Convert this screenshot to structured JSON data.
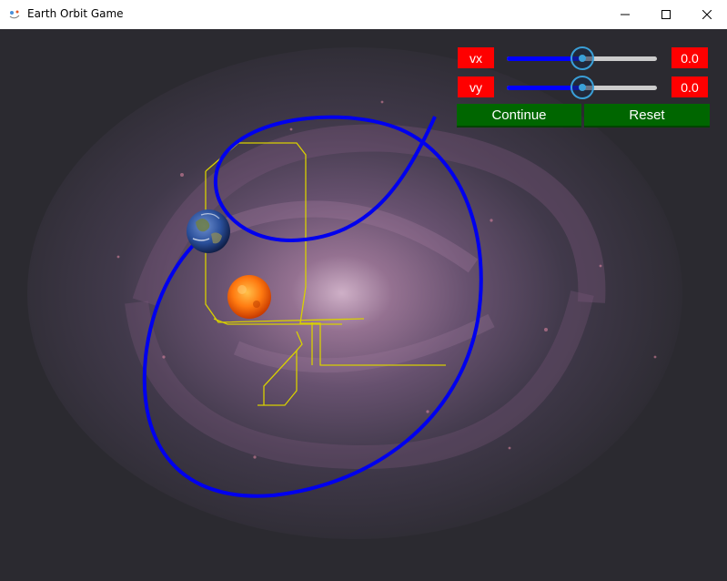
{
  "window": {
    "title": "Earth Orbit Game",
    "controls": [
      "minimize",
      "maximize",
      "close"
    ]
  },
  "icons": {
    "app": "orbit-icon",
    "minimize": "minimize-icon",
    "maximize": "maximize-icon",
    "close": "close-icon"
  },
  "controls": {
    "vx": {
      "label": "vx",
      "value_text": "0.0",
      "slider_fraction": 0.5
    },
    "vy": {
      "label": "vy",
      "value_text": "0.0",
      "slider_fraction": 0.5
    },
    "continue_label": "Continue",
    "reset_label": "Reset"
  },
  "colors": {
    "label_bg": "#ff0000",
    "button_bg": "#006600",
    "slider_fill": "#0000ff",
    "slider_rest": "#cccccc",
    "slider_thumb": "#3aa0d8",
    "orbit_path": "#0000ee",
    "grid_lines": "#d8d000",
    "sun": "#ff6a00",
    "earth": "#2a4f9a",
    "background": "#2b2a30"
  },
  "scene": {
    "bodies": [
      "earth",
      "sun"
    ],
    "background": "galaxy"
  }
}
